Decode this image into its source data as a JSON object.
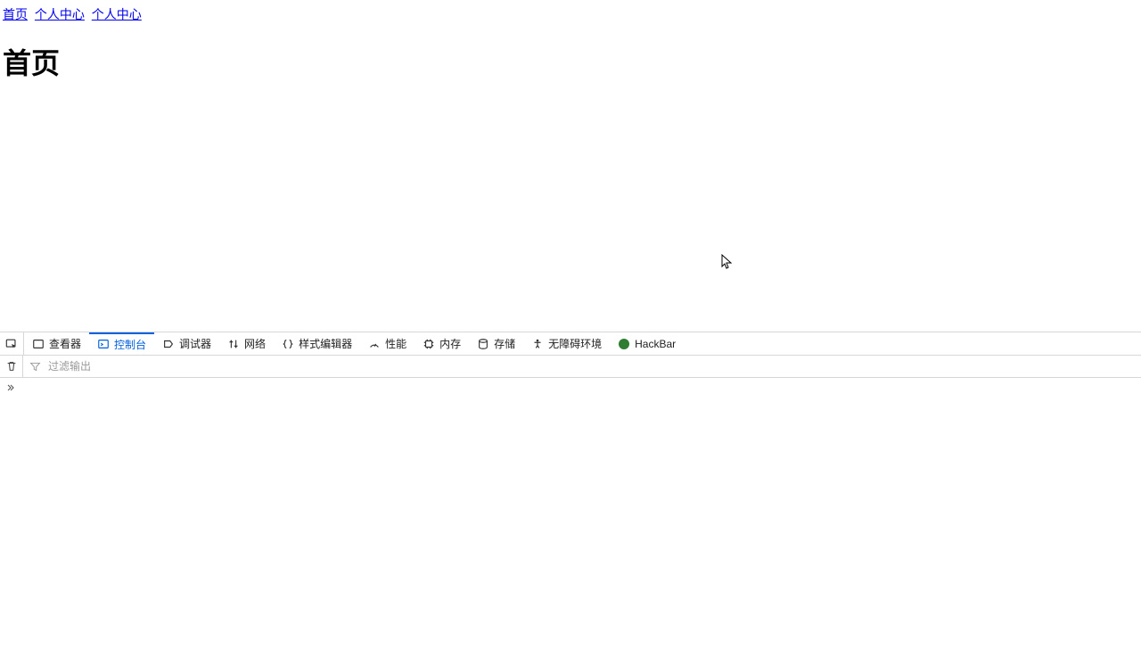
{
  "nav": {
    "links": [
      "首页",
      "个人中心",
      "个人中心"
    ]
  },
  "page": {
    "heading": "首页"
  },
  "devtools": {
    "tabs": {
      "inspector": "查看器",
      "console": "控制台",
      "debugger": "调试器",
      "network": "网络",
      "styleeditor": "样式编辑器",
      "performance": "性能",
      "memory": "内存",
      "storage": "存储",
      "accessibility": "无障碍环境",
      "hackbar": "HackBar"
    },
    "active_tab": "console",
    "filter_placeholder": "过滤输出"
  }
}
